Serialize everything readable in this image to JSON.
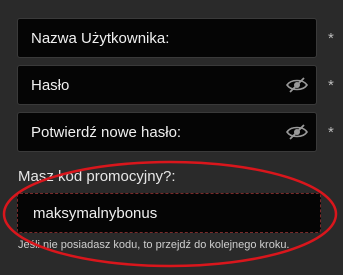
{
  "form": {
    "username": {
      "placeholder": "Nazwa Użytkownika:",
      "required_mark": "*"
    },
    "password": {
      "placeholder": "Hasło",
      "required_mark": "*",
      "toggle_icon": "eye-slash-icon"
    },
    "confirm_password": {
      "placeholder": "Potwierdź nowe hasło:",
      "required_mark": "*",
      "toggle_icon": "eye-slash-icon"
    },
    "promo": {
      "label": "Masz kod promocyjny?:",
      "value": "maksymalnybonus",
      "hint": "Jeśli nie posiadasz kodu, to przejdź do kolejnego kroku."
    }
  },
  "annotation": {
    "color": "#d9161c"
  },
  "colors": {
    "background": "#2a2a2a",
    "field": "#050505",
    "field_border": "#3a3a3a",
    "promo_border": "#7a2a2a"
  }
}
